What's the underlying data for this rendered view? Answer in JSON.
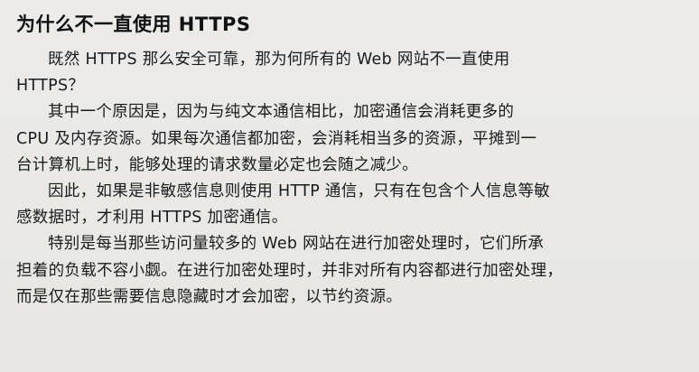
{
  "article": {
    "title": "为什么不一直使用 HTTPS",
    "paragraphs": [
      {
        "lines": [
          "既然 HTTPS 那么安全可靠，那为何所有的 Web 网站不一直使用",
          "HTTPS？"
        ]
      },
      {
        "lines": [
          "其中一个原因是，因为与纯文本通信相比，加密通信会消耗更多的",
          "CPU 及内存资源。如果每次通信都加密，会消耗相当多的资源，平摊到一",
          "台计算机上时，能够处理的请求数量必定也会随之减少。"
        ]
      },
      {
        "lines": [
          "因此，如果是非敏感信息则使用 HTTP 通信，只有在包含个人信息等敏",
          "感数据时，才利用 HTTPS 加密通信。"
        ]
      },
      {
        "lines": [
          "特别是每当那些访问量较多的 Web 网站在进行加密处理时，它们所承",
          "担着的负载不容小觑。在进行加密处理时，并非对所有内容都进行加密处理，",
          "而是仅在那些需要信息隐藏时才会加密，以节约资源。"
        ]
      }
    ]
  }
}
